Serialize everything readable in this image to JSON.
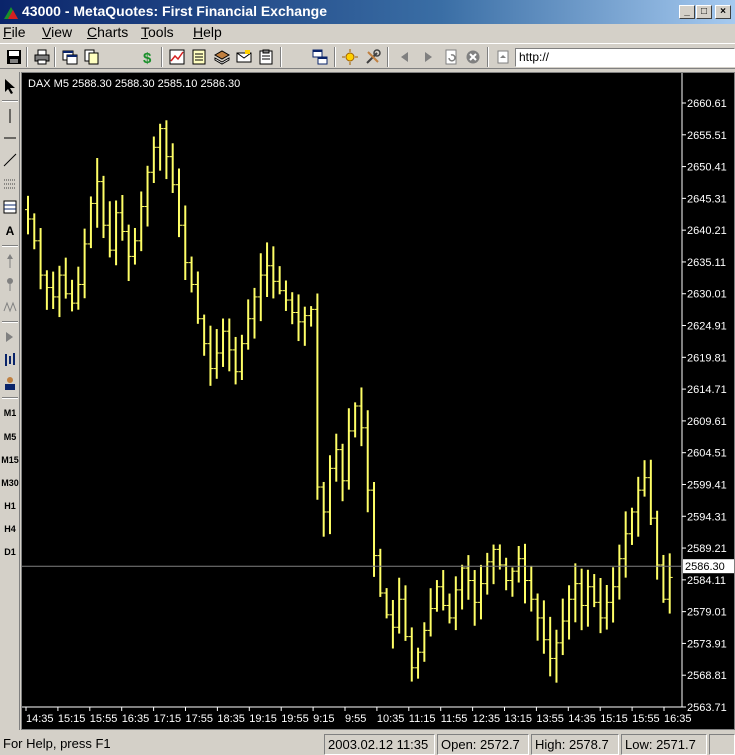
{
  "window": {
    "title": "43000 - MetaQuotes: First Financial Exchange",
    "controls": {
      "minimize": "_",
      "maximize": "□",
      "close": "×"
    }
  },
  "menu": {
    "items": [
      {
        "label": "File",
        "key": "F",
        "rest": "ile"
      },
      {
        "label": "View",
        "key": "V",
        "rest": "iew"
      },
      {
        "label": "Charts",
        "key": "C",
        "rest": "harts"
      },
      {
        "label": "Tools",
        "key": "T",
        "rest": "ools"
      },
      {
        "label": "Help",
        "key": "H",
        "rest": "elp"
      }
    ]
  },
  "toolbar": {
    "url_value": "http://",
    "icons": [
      "save-icon",
      "print-icon",
      "new-window-icon",
      "copy-icon",
      "dollar-icon",
      "line-chart-icon",
      "list-icon",
      "book-icon",
      "mail-icon",
      "clipboard-icon",
      "tile-windows-icon",
      "sun-icon",
      "tools-icon",
      "back-icon",
      "forward-icon",
      "refresh-icon",
      "stop-icon",
      "home-icon"
    ]
  },
  "left_toolbar": {
    "timeframes": [
      "M1",
      "M5",
      "M15",
      "M30",
      "H1",
      "H4",
      "D1"
    ],
    "text_tool": "A"
  },
  "chart_data": {
    "type": "bar",
    "symbol": "DAX",
    "timeframe": "M5",
    "header": "DAX M5  2588.30  2588.30  2585.10  2586.30",
    "ohlc": {
      "open": 2588.3,
      "high": 2588.3,
      "low": 2585.1,
      "close": 2586.3
    },
    "current_price": "2586.30",
    "ylim": [
      2563.71,
      2660.61
    ],
    "y_ticks": [
      "2660.61",
      "2655.51",
      "2650.41",
      "2645.31",
      "2640.21",
      "2635.11",
      "2630.01",
      "2624.91",
      "2619.81",
      "2614.71",
      "2609.61",
      "2604.51",
      "2599.41",
      "2594.31",
      "2589.21",
      "2584.11",
      "2579.01",
      "2573.91",
      "2568.81",
      "2563.71"
    ],
    "x_ticks": [
      "14:35",
      "15:15",
      "15:55",
      "16:35",
      "17:15",
      "17:55",
      "18:35",
      "19:15",
      "19:55",
      "9:15",
      "9:55",
      "10:35",
      "11:15",
      "11:55",
      "12:35",
      "13:15",
      "13:55",
      "14:35",
      "15:15",
      "15:55",
      "16:35"
    ],
    "colors": {
      "background": "#000000",
      "bars": "#ffff66",
      "axis_text": "#ffffff",
      "price_line": "#808080"
    },
    "closes": [
      2642.0,
      2638.5,
      2633.0,
      2631.0,
      2629.5,
      2633.0,
      2630.0,
      2628.5,
      2631.5,
      2638.0,
      2644.5,
      2648.0,
      2641.0,
      2637.0,
      2643.0,
      2640.0,
      2636.0,
      2638.5,
      2644.0,
      2649.5,
      2653.5,
      2656.5,
      2652.0,
      2647.5,
      2641.0,
      2635.0,
      2631.5,
      2626.0,
      2622.0,
      2618.0,
      2620.5,
      2624.0,
      2621.0,
      2617.5,
      2622.0,
      2626.0,
      2629.5,
      2633.0,
      2634.5,
      2632.0,
      2630.5,
      2629.0,
      2627.0,
      2625.5,
      2626.5,
      2627.5,
      2599.0,
      2595.0,
      2602.0,
      2605.0,
      2600.0,
      2608.0,
      2612.0,
      2608.5,
      2598.5,
      2588.0,
      2582.0,
      2578.5,
      2576.5,
      2581.0,
      2575.0,
      2570.0,
      2572.5,
      2576.0,
      2579.5,
      2583.0,
      2580.0,
      2578.0,
      2582.5,
      2586.0,
      2584.0,
      2580.5,
      2583.5,
      2587.0,
      2589.0,
      2586.5,
      2584.0,
      2585.5,
      2587.5,
      2584.0,
      2581.0,
      2578.0,
      2574.5,
      2571.5,
      2574.0,
      2577.5,
      2581.0,
      2583.5,
      2580.0,
      2583.0,
      2580.5,
      2578.0,
      2580.5,
      2583.0,
      2587.5,
      2591.5,
      2595.0,
      2598.5,
      2600.5,
      2594.0,
      2586.5,
      2581.0,
      2584.5
    ]
  },
  "status": {
    "help": "For Help, press F1",
    "datetime": "2003.02.12 11:35",
    "open": "Open: 2572.7",
    "high": "High: 2578.7",
    "low": "Low: 2571.7"
  }
}
